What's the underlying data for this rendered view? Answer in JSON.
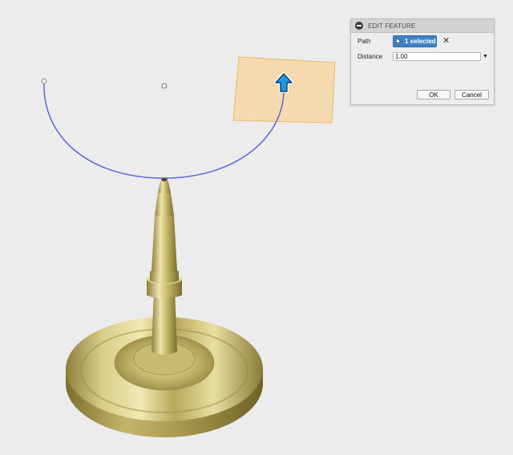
{
  "panel": {
    "title": "EDIT FEATURE",
    "path_label": "Path",
    "path_selection": "1 selected",
    "distance_label": "Distance",
    "distance_value": "1.00",
    "ok_label": "OK",
    "cancel_label": "Cancel"
  },
  "colors": {
    "viewport_bg": "#ececec",
    "path_curve": "#5b63e0",
    "plane": "#f6d7a3",
    "model_gold": "#d4c77d",
    "selection_accent": "#3f83c6"
  },
  "icons": [
    "collapse-icon",
    "cursor-icon",
    "clear-icon",
    "dropdown-icon",
    "arrow-up-icon"
  ]
}
